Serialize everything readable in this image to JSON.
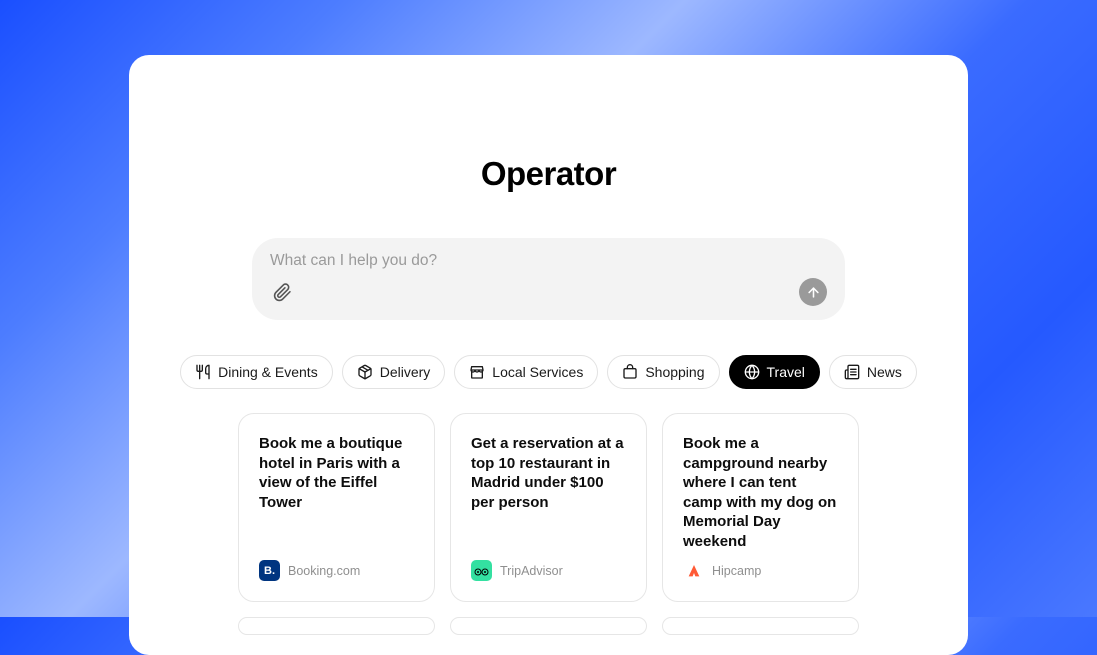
{
  "app": {
    "title": "Operator"
  },
  "input": {
    "placeholder": "What can I help you do?",
    "value": ""
  },
  "categories": [
    {
      "label": "Dining & Events",
      "icon": "utensils",
      "active": false
    },
    {
      "label": "Delivery",
      "icon": "package",
      "active": false
    },
    {
      "label": "Local Services",
      "icon": "store",
      "active": false
    },
    {
      "label": "Shopping",
      "icon": "shopping-bag",
      "active": false
    },
    {
      "label": "Travel",
      "icon": "globe",
      "active": true
    },
    {
      "label": "News",
      "icon": "newspaper",
      "active": false
    }
  ],
  "cards": [
    {
      "prompt": "Book me a boutique hotel in Paris with a view of the Eiffel Tower",
      "source": "Booking.com",
      "source_icon": "booking"
    },
    {
      "prompt": "Get a reservation at a top 10 restaurant in Madrid under $100 per person",
      "source": "TripAdvisor",
      "source_icon": "tripadvisor"
    },
    {
      "prompt": "Book me a campground nearby where I can tent camp with my dog on Memorial Day weekend",
      "source": "Hipcamp",
      "source_icon": "hipcamp"
    }
  ]
}
